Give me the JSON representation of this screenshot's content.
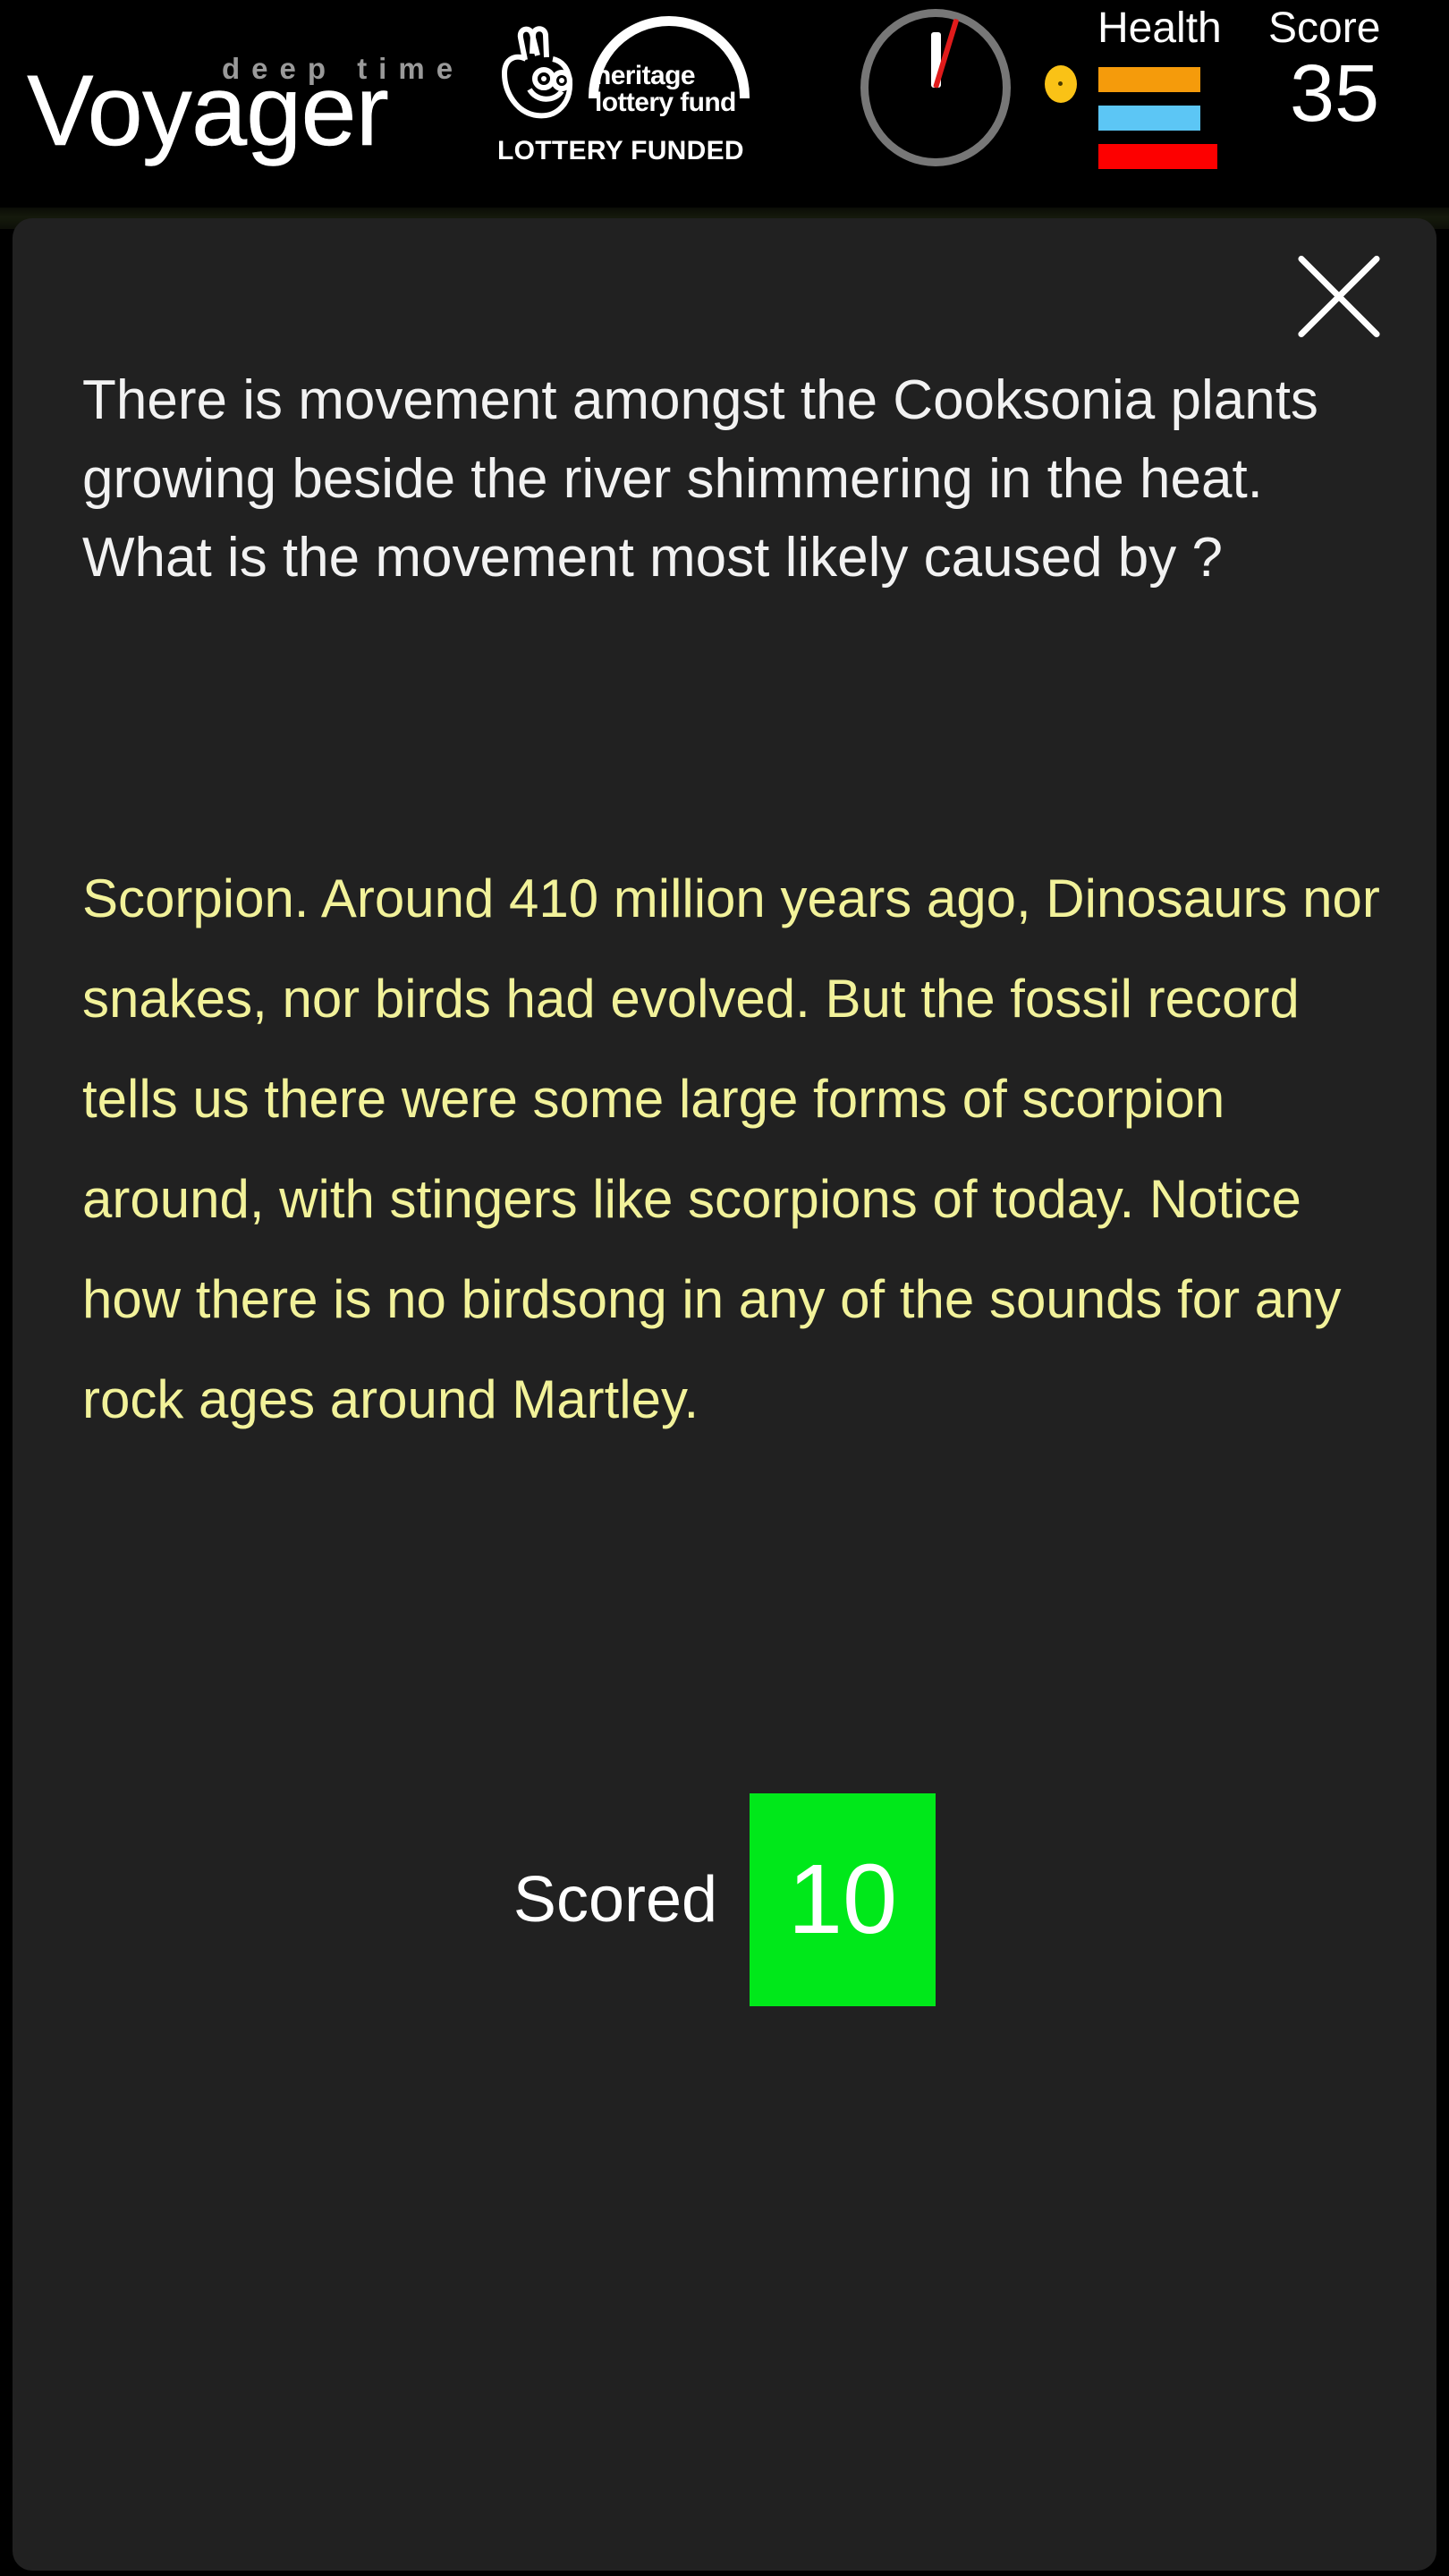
{
  "header": {
    "brand": {
      "superscript": "deep time",
      "name": "Voyager"
    },
    "funder": {
      "org_line1": "heritage",
      "org_line2": "lottery fund",
      "strapline": "LOTTERY FUNDED",
      "icon_name": "crossed-fingers-icon"
    },
    "clock": {
      "icon_name": "clock-gauge-icon"
    },
    "status": {
      "health_label": "Health",
      "score_label": "Score",
      "score_value": "35",
      "health_bars": [
        {
          "name": "health-bar-orange",
          "color": "#f59b0b"
        },
        {
          "name": "health-bar-blue",
          "color": "#5cc6f5"
        },
        {
          "name": "health-bar-red",
          "color": "#fd0000"
        }
      ],
      "marker_color": "#fac216"
    }
  },
  "overlay": {
    "close_label": "close-icon",
    "question": "There is movement amongst the Cooksonia plants growing beside the river shimmering in the heat. What is the movement most likely caused by ?",
    "answer": "Scorpion. Around 410 million years ago, Dinosaurs nor snakes, nor birds had evolved. But the fossil record tells us there were some large forms of scorpion around, with stingers like scorpions of today. Notice how there is no birdsong in any of the sounds for any rock ages around Martley.",
    "scored_label": "Scored",
    "scored_value": "10",
    "scored_badge_color": "#00e81a",
    "answer_text_color": "#f2f29a",
    "panel_color": "#212121"
  }
}
